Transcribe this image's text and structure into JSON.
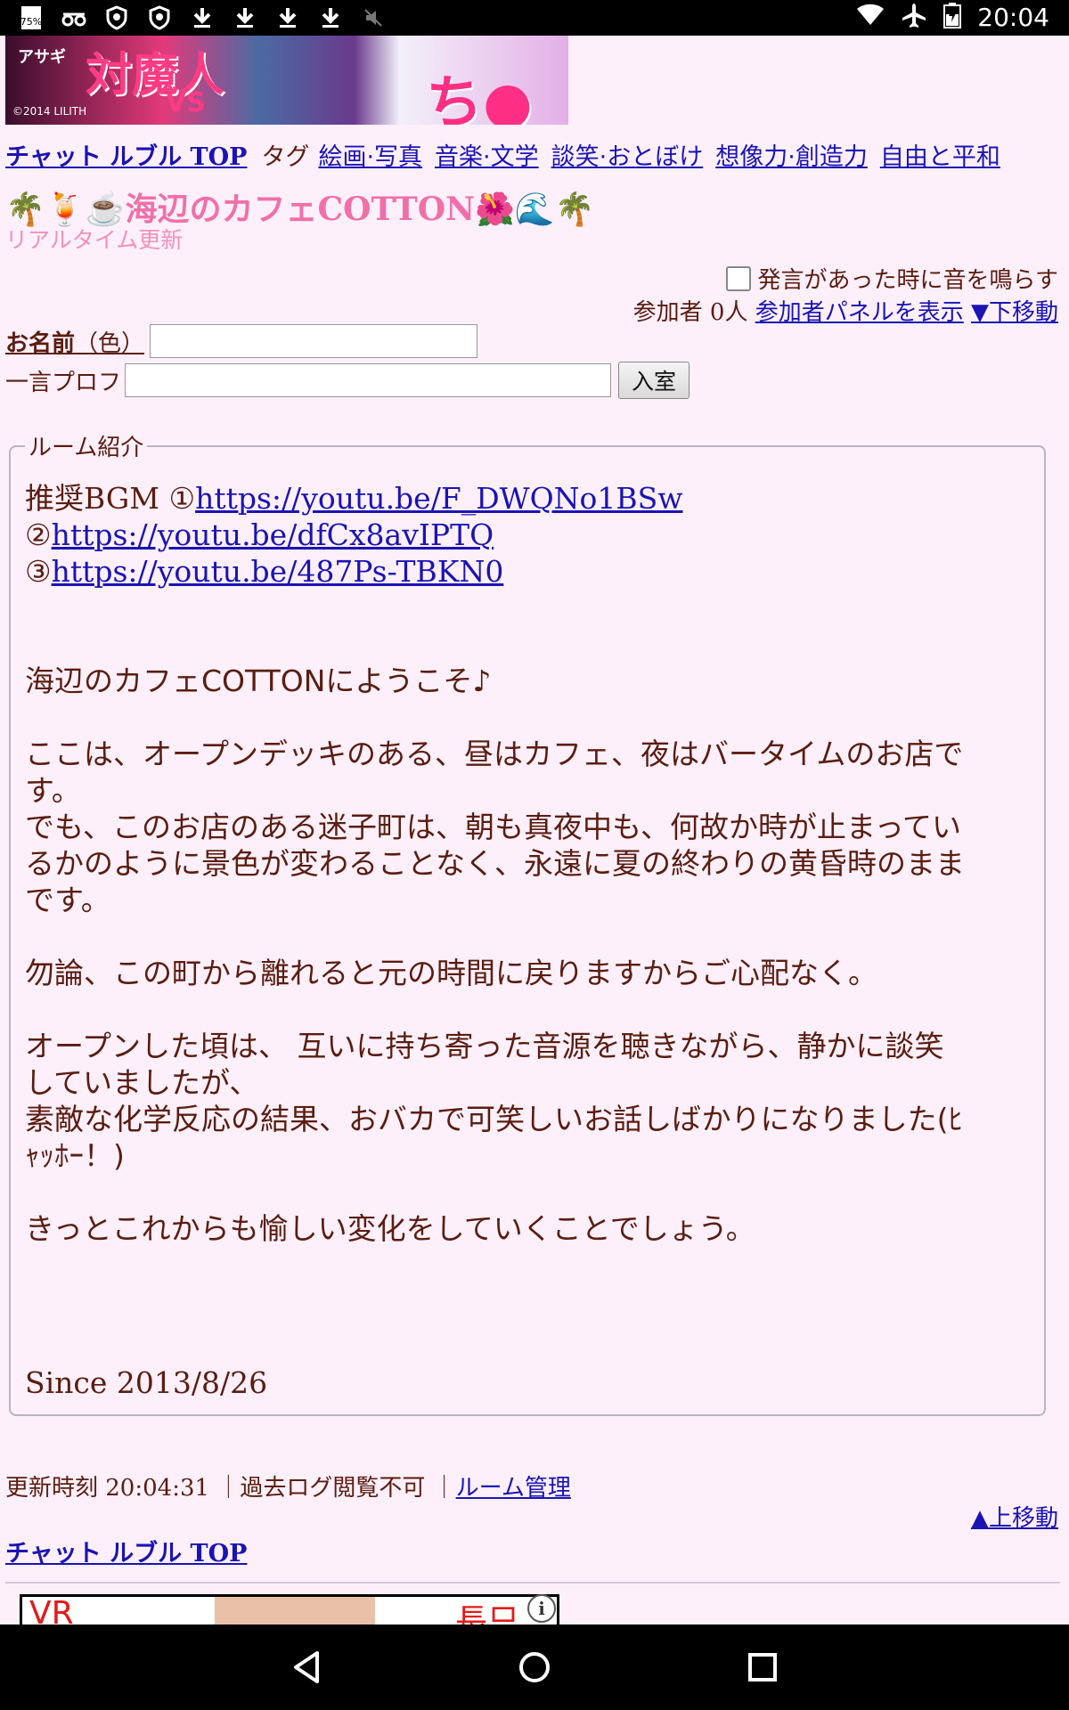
{
  "status_bar": {
    "time": "20:04",
    "battery_level_pct": 75,
    "left_icons": [
      "battery-percent-icon",
      "glasses-icon",
      "shield-icon",
      "shield-icon",
      "download-icon",
      "download-icon",
      "download-icon",
      "download-icon",
      "mute-icon"
    ],
    "right_icons": [
      "wifi-icon",
      "airplane-icon",
      "battery-icon"
    ]
  },
  "banner": {
    "text_main": "対魔人",
    "text_vs": "VS",
    "text_right": "ち●こ",
    "copyright": "©2014 LILITH",
    "logo_text": "アサギ"
  },
  "nav": {
    "top_link": "チャット ルブル TOP",
    "tag_label": "タグ",
    "tags": [
      "絵画·写真",
      "音楽·文学",
      "談笑·おとぼけ",
      "想像力·創造力",
      "自由と平和"
    ]
  },
  "room": {
    "title": "🌴🍹☕海辺のカフェCOTTON🌺🌊🌴",
    "subtitle": "リアルタイム更新",
    "sound_label": "発言があった時に音を鳴らす",
    "participants_label": "参加者 0人",
    "panel_link": "参加者パネルを表示",
    "down_link": "▼下移動"
  },
  "form": {
    "name_label": "お名前",
    "color_label": "（色）",
    "name_value": "",
    "profile_label": "一言プロフ",
    "profile_value": "",
    "enter_button": "入室"
  },
  "intro": {
    "legend": "ルーム紹介",
    "bgm_prefix": "推奨BGM ①",
    "bgm1": "https://youtu.be/F_DWQNo1BSw",
    "bgm2_prefix": "②",
    "bgm2": "https://youtu.be/dfCx8avIPTQ",
    "bgm3_prefix": "③",
    "bgm3": "https://youtu.be/487Ps-TBKN0",
    "p1": "海辺のカフェCOTTONにようこそ♪",
    "p2a": "ここは、オープンデッキのある、昼はカフェ、夜はバータイムのお店で",
    "p2b": "す。",
    "p2c": "でも、このお店のある迷子町は、朝も真夜中も、何故か時が止まってい",
    "p2d": "るかのように景色が変わることなく、永遠に夏の終わりの黄昏時のまま",
    "p2e": "です。",
    "p3": "勿論、この町から離れると元の時間に戻りますからご心配なく。",
    "p4a": "オープンした頃は、 互いに持ち寄った音源を聴きながら、静かに談笑",
    "p4b": "していましたが、",
    "p4c": "素敵な化学反応の結果、おバカで可笑しいお話しばかりになりました(ﾋ",
    "p4d": "ｬｯﾎｰ！)",
    "p5": "きっとこれからも愉しい変化をしていくことでしょう。",
    "since": "Since 2013/8/26"
  },
  "footer": {
    "updated": "更新時刻 20:04:31",
    "sep": "｜",
    "log": "過去ログ閲覧不可",
    "manage": "ルーム管理",
    "up_link": "▲上移動",
    "top_link": "チャット ルブル TOP"
  },
  "ad2": {
    "text_left": "VR",
    "text_right": "長只"
  }
}
